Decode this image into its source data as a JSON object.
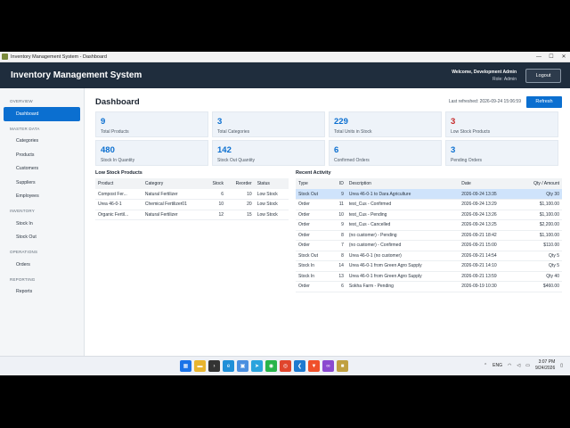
{
  "window": {
    "title": "Inventory Management System - Dashboard",
    "minimize": "—",
    "maximize": "☐",
    "close": "✕"
  },
  "header": {
    "app_title": "Inventory Management System",
    "welcome": "Welcome, Development Admin",
    "role": "Role: Admin",
    "logout": "Logout"
  },
  "sidebar": {
    "sections": [
      {
        "title": "OVERVIEW",
        "items": [
          "Dashboard"
        ]
      },
      {
        "title": "MASTER DATA",
        "items": [
          "Categories",
          "Products",
          "Customers",
          "Suppliers",
          "Employees"
        ]
      },
      {
        "title": "INVENTORY",
        "items": [
          "Stock In",
          "Stock Out"
        ]
      },
      {
        "title": "OPERATIONS",
        "items": [
          "Orders"
        ]
      },
      {
        "title": "REPORTING",
        "items": [
          "Reports"
        ]
      }
    ],
    "active": "Dashboard"
  },
  "dashboard": {
    "title": "Dashboard",
    "last_refreshed": "Last refreshed: 2026-09-24 15:06:59",
    "refresh": "Refresh"
  },
  "cards": [
    {
      "value": "9",
      "label": "Total Products"
    },
    {
      "value": "3",
      "label": "Total Categories"
    },
    {
      "value": "229",
      "label": "Total Units in Stock"
    },
    {
      "value": "3",
      "label": "Low Stock Products",
      "warn": true
    },
    {
      "value": "480",
      "label": "Stock In Quantity"
    },
    {
      "value": "142",
      "label": "Stock Out Quantity"
    },
    {
      "value": "6",
      "label": "Confirmed Orders"
    },
    {
      "value": "3",
      "label": "Pending Orders"
    }
  ],
  "low_stock": {
    "title": "Low Stock Products",
    "columns": [
      "Product",
      "Category",
      "Stock",
      "Reorder",
      "Status"
    ],
    "rows": [
      [
        "Compost Fer...",
        "Natural Fertilizer",
        "6",
        "10",
        "Low Stock"
      ],
      [
        "Urea 46-0-1",
        "Chemical Fertilizer01",
        "10",
        "20",
        "Low Stock"
      ],
      [
        "Organic Fertil...",
        "Natural Fertilizer",
        "12",
        "15",
        "Low Stock"
      ]
    ]
  },
  "recent_activity": {
    "title": "Recent Activity",
    "columns": [
      "Type",
      "ID",
      "Description",
      "Date",
      "Qty / Amount"
    ],
    "rows": [
      [
        "Stock Out",
        "9",
        "Urea 46-0-1 to Dara Agriculture",
        "2026-09-24 13:35",
        "Qty 30"
      ],
      [
        "Order",
        "11",
        "test_Cus - Confirmed",
        "2026-09-24 13:29",
        "$1,100.00"
      ],
      [
        "Order",
        "10",
        "test_Cus - Pending",
        "2026-09-24 13:26",
        "$1,100.00"
      ],
      [
        "Order",
        "9",
        "test_Cus - Cancelled",
        "2026-09-24 13:25",
        "$2,200.00"
      ],
      [
        "Order",
        "8",
        "(no customer) - Pending",
        "2026-09-21 18:42",
        "$1,100.00"
      ],
      [
        "Order",
        "7",
        "(no customer) - Confirmed",
        "2026-09-21 15:00",
        "$110.00"
      ],
      [
        "Stock Out",
        "8",
        "Urea 46-0-1 (no customer)",
        "2026-09-21 14:54",
        "Qty 5"
      ],
      [
        "Stock In",
        "14",
        "Urea 46-0-1 from Green Agro Supply",
        "2026-09-21 14:10",
        "Qty 5"
      ],
      [
        "Stock In",
        "13",
        "Urea 46-0-1 from Green Agro Supply",
        "2026-09-21 13:59",
        "Qty 40"
      ],
      [
        "Order",
        "6",
        "Sokha Farm - Pending",
        "2026-09-19 10:30",
        "$460.00"
      ]
    ]
  },
  "taskbar": {
    "icons": [
      {
        "name": "windows-start-icon",
        "color": "#1a73e8",
        "glyph": "▦"
      },
      {
        "name": "file-explorer-icon",
        "color": "#e8b530",
        "glyph": "▬"
      },
      {
        "name": "terminal-icon",
        "color": "#333333",
        "glyph": "›"
      },
      {
        "name": "edge-icon",
        "color": "#1f8fd8",
        "glyph": "e"
      },
      {
        "name": "store-icon",
        "color": "#4a8fe0",
        "glyph": "▣"
      },
      {
        "name": "telegram-icon",
        "color": "#2aa3dd",
        "glyph": "➤"
      },
      {
        "name": "whatsapp-icon",
        "color": "#28b44a",
        "glyph": "◉"
      },
      {
        "name": "chrome-icon",
        "color": "#e0452c",
        "glyph": "◎"
      },
      {
        "name": "vscode-icon",
        "color": "#1e7ad0",
        "glyph": "❮"
      },
      {
        "name": "brave-icon",
        "color": "#f0502a",
        "glyph": "▼"
      },
      {
        "name": "visual-studio-icon",
        "color": "#8a4ad0",
        "glyph": "∞"
      },
      {
        "name": "app-icon",
        "color": "#c0a040",
        "glyph": "■"
      }
    ],
    "lang": "ENG",
    "time": "3:07 PM",
    "date": "9/24/2026"
  }
}
